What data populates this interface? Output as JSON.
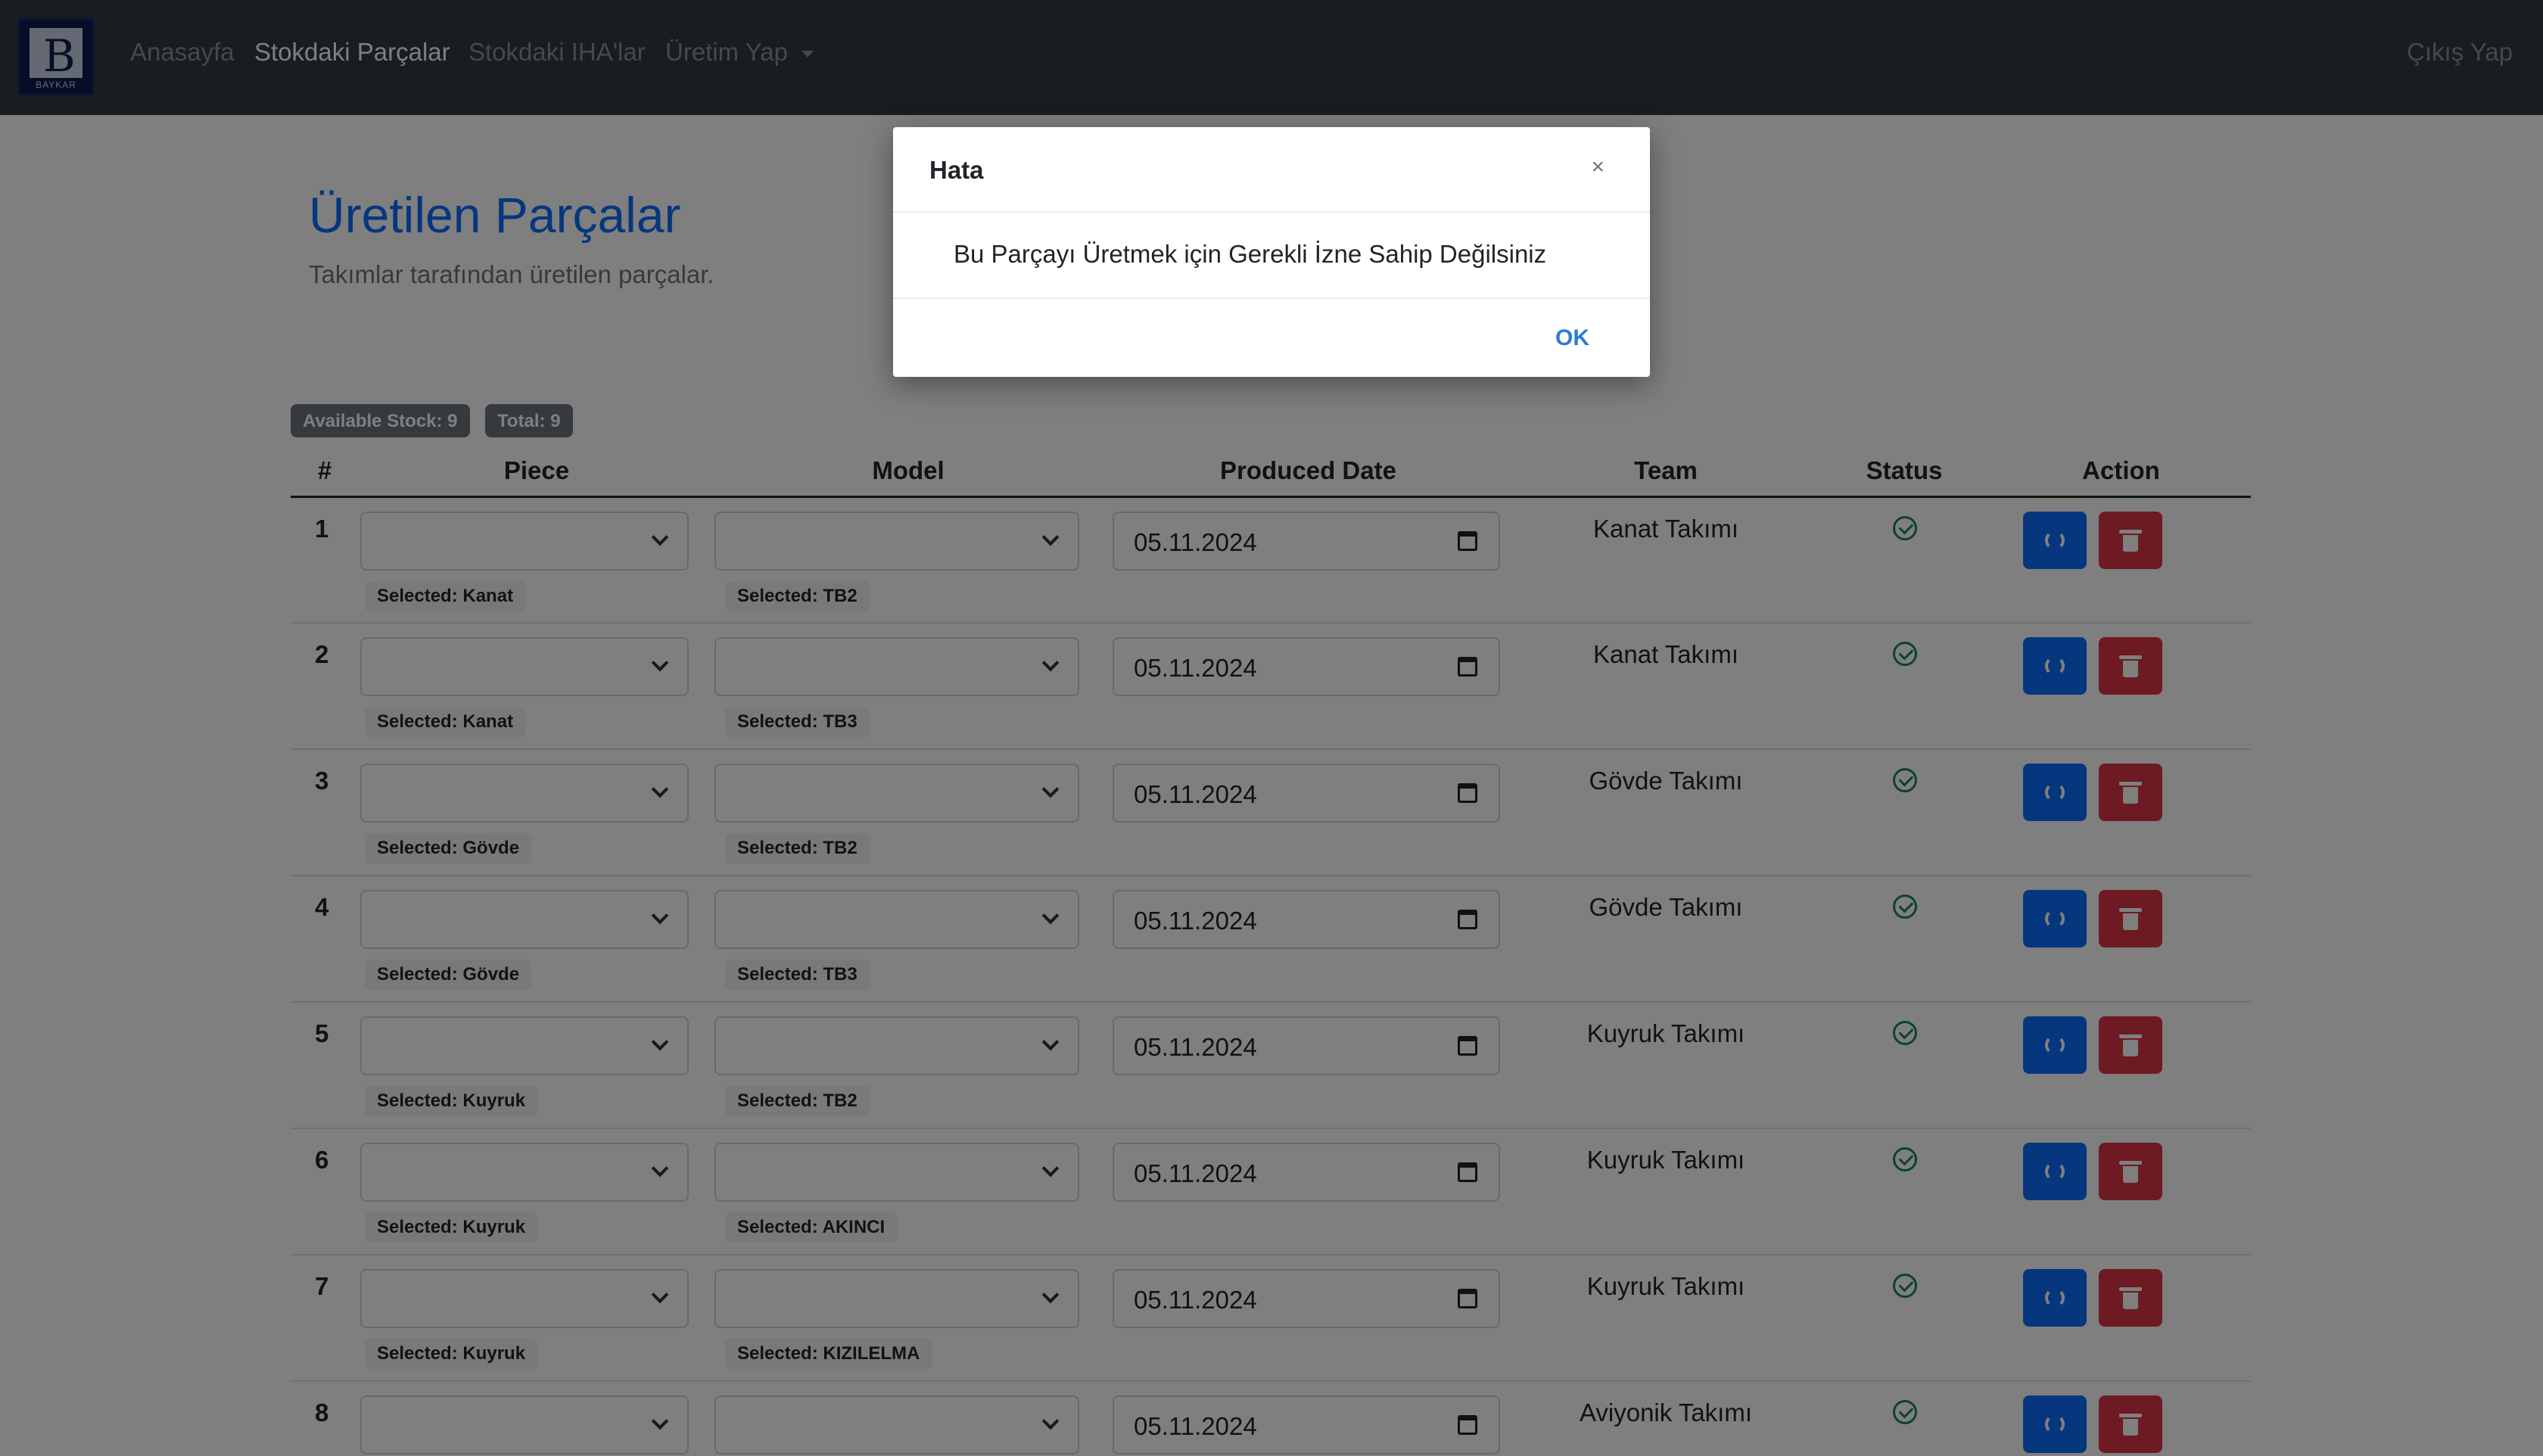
{
  "navbar": {
    "logo_text": "BAYKAR",
    "links": [
      "Anasayfa",
      "Stokdaki Parçalar",
      "Stokdaki IHA'lar",
      "Üretim Yap"
    ],
    "active_index": 1,
    "logout": "Çıkış Yap"
  },
  "page": {
    "title": "Üretilen Parçalar",
    "subtitle": "Takımlar tarafından üretilen parçalar."
  },
  "badges": {
    "available": "Available Stock: 9",
    "total": "Total: 9"
  },
  "table": {
    "headers": [
      "#",
      "Piece",
      "Model",
      "Produced Date",
      "Team",
      "Status",
      "Action"
    ],
    "rows": [
      {
        "num": "1",
        "piece": "Selected: Kanat",
        "model": "Selected: TB2",
        "date": "05.11.2024",
        "team": "Kanat Takımı"
      },
      {
        "num": "2",
        "piece": "Selected: Kanat",
        "model": "Selected: TB3",
        "date": "05.11.2024",
        "team": "Kanat Takımı"
      },
      {
        "num": "3",
        "piece": "Selected: Gövde",
        "model": "Selected: TB2",
        "date": "05.11.2024",
        "team": "Gövde Takımı"
      },
      {
        "num": "4",
        "piece": "Selected: Gövde",
        "model": "Selected: TB3",
        "date": "05.11.2024",
        "team": "Gövde Takımı"
      },
      {
        "num": "5",
        "piece": "Selected: Kuyruk",
        "model": "Selected: TB2",
        "date": "05.11.2024",
        "team": "Kuyruk Takımı"
      },
      {
        "num": "6",
        "piece": "Selected: Kuyruk",
        "model": "Selected: AKINCI",
        "date": "05.11.2024",
        "team": "Kuyruk Takımı"
      },
      {
        "num": "7",
        "piece": "Selected: Kuyruk",
        "model": "Selected: KIZILELMA",
        "date": "05.11.2024",
        "team": "Kuyruk Takımı"
      },
      {
        "num": "8",
        "piece": "",
        "model": "",
        "date": "05.11.2024",
        "team": "Aviyonik Takımı"
      }
    ]
  },
  "modal": {
    "title": "Hata",
    "close": "×",
    "message": "Bu Parçayı Üretmek için Gerekli İzne Sahip Değilsiniz",
    "ok": "OK"
  },
  "colors": {
    "navbar": "#343a40",
    "primary": "#0d6efd",
    "danger": "#dc3545",
    "success": "#198754"
  }
}
